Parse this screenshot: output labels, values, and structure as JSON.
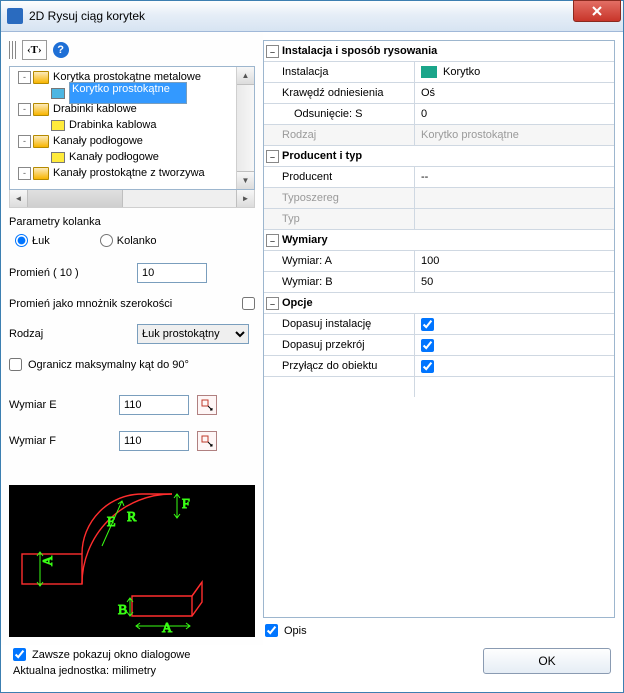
{
  "window": {
    "title": "2D Rysuj ciąg korytek"
  },
  "toolbar": {
    "text_tool": "‹T›",
    "help": "?"
  },
  "tree": {
    "items": [
      {
        "indent": 0,
        "expander": "-",
        "icon": "folder",
        "label": "Korytka prostokątne metalowe"
      },
      {
        "indent": 1,
        "expander": "",
        "icon": "item-blue",
        "label": "Korytko prostokątne",
        "selected": true
      },
      {
        "indent": 0,
        "expander": "-",
        "icon": "folder",
        "label": "Drabinki kablowe"
      },
      {
        "indent": 1,
        "expander": "",
        "icon": "item-yellow",
        "label": "Drabinka kablowa"
      },
      {
        "indent": 0,
        "expander": "-",
        "icon": "folder",
        "label": "Kanały podłogowe"
      },
      {
        "indent": 1,
        "expander": "",
        "icon": "item-yellow",
        "label": "Kanały podłogowe"
      },
      {
        "indent": 0,
        "expander": "-",
        "icon": "folder",
        "label": "Kanały prostokątne z tworzywa"
      }
    ]
  },
  "left_group": {
    "params_title": "Parametry kolanka",
    "radio_luk": "Łuk",
    "radio_kolanko": "Kolanko",
    "promien_label": "Promień ( 10 )",
    "promien_value": "10",
    "promien_mnoznik_label": "Promień jako mnożnik szerokości",
    "rodzaj_label": "Rodzaj",
    "rodzaj_value": "Łuk prostokątny",
    "ogranicz_label": "Ogranicz maksymalny kąt do 90°",
    "wymiar_e_label": "Wymiar E",
    "wymiar_e_value": "110",
    "wymiar_f_label": "Wymiar F",
    "wymiar_f_value": "110"
  },
  "pgrid": {
    "cat1": "Instalacja i sposób rysowania",
    "instalacja_k": "Instalacja",
    "instalacja_v": "Korytko",
    "instalacja_color": "#1aa58a",
    "krawedz_k": "Krawędź odniesienia",
    "krawedz_v": "Oś",
    "odsun_k": "Odsunięcie: S",
    "odsun_v": "0",
    "rodzaj_k": "Rodzaj",
    "rodzaj_v": "Korytko prostokątne",
    "cat2": "Producent i typ",
    "producent_k": "Producent",
    "producent_v": "--",
    "typoszereg_k": "Typoszereg",
    "typoszereg_v": "",
    "typ_k": "Typ",
    "typ_v": "",
    "cat3": "Wymiary",
    "wym_a_k": "Wymiar: A",
    "wym_a_v": "100",
    "wym_b_k": "Wymiar: B",
    "wym_b_v": "50",
    "cat4": "Opcje",
    "dopasuj_inst_k": "Dopasuj instalację",
    "dopasuj_przek_k": "Dopasuj przekrój",
    "przylacz_k": "Przyłącz do obiektu"
  },
  "opis_label": "Opis",
  "footer": {
    "always_show": "Zawsze pokazuj okno dialogowe",
    "units": "Aktualna jednostka: milimetry",
    "ok": "OK"
  }
}
